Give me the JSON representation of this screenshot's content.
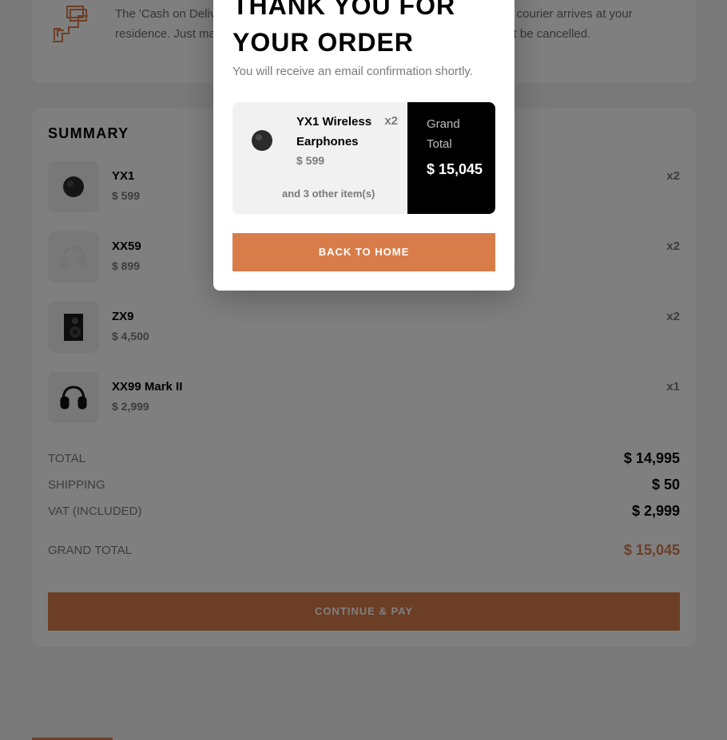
{
  "payment_info": {
    "text": "The 'Cash on Delivery' option enables you to pay in cash when our delivery courier arrives at your residence. Just make sure your address is correct so that your order will not be cancelled.",
    "icon": "cash-on-delivery-icon"
  },
  "summary": {
    "title": "SUMMARY",
    "items": [
      {
        "name": "YX1",
        "price": "$ 599",
        "qty": "x2",
        "icon": "earphones-icon"
      },
      {
        "name": "XX59",
        "price": "$ 899",
        "qty": "x2",
        "icon": "headphones-white-icon"
      },
      {
        "name": "ZX9",
        "price": "$ 4,500",
        "qty": "x2",
        "icon": "speaker-icon"
      },
      {
        "name": "XX99 Mark II",
        "price": "$ 2,999",
        "qty": "x1",
        "icon": "headphones-black-icon"
      }
    ],
    "total_label": "TOTAL",
    "total_value": "$ 14,995",
    "shipping_label": "SHIPPING",
    "shipping_value": "$ 50",
    "vat_label": "VAT (INCLUDED)",
    "vat_value": "$ 2,999",
    "grand_label": "GRAND TOTAL",
    "grand_value": "$ 15,045",
    "pay_button": "CONTINUE & PAY"
  },
  "modal": {
    "title": "THANK YOU FOR YOUR ORDER",
    "subtitle": "You will receive an email confirmation shortly.",
    "item_name": "YX1 Wireless Earphones",
    "item_price": "$ 599",
    "item_qty": "x2",
    "more_items": "and 3 other item(s)",
    "grand_label": "Grand Total",
    "grand_value": "$ 15,045",
    "home_button": "BACK TO HOME"
  },
  "colors": {
    "accent": "#d87d4a",
    "dark": "#000000",
    "muted": "#7a7a7a"
  }
}
